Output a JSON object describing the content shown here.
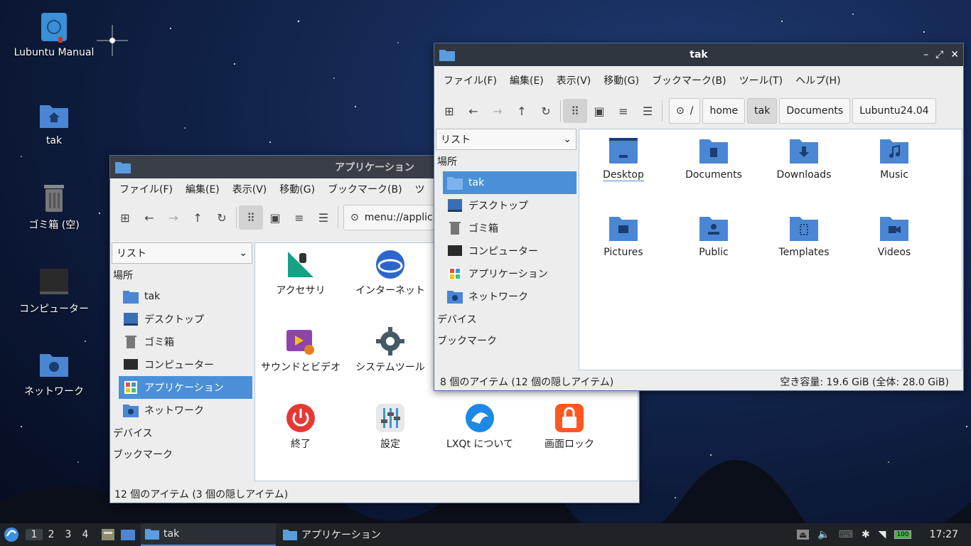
{
  "desktop": {
    "icons": [
      {
        "label": "Lubuntu Manual"
      },
      {
        "label": "tak"
      },
      {
        "label": "ゴミ箱 (空)"
      },
      {
        "label": "コンピューター"
      },
      {
        "label": "ネットワーク"
      }
    ]
  },
  "apps_window": {
    "title": "アプリケーション",
    "menu": [
      "ファイル(F)",
      "編集(E)",
      "表示(V)",
      "移動(G)",
      "ブックマーク(B)",
      "ツ"
    ],
    "location": "menu://applic",
    "view_select": "リスト",
    "sections": {
      "places": "場所",
      "devices": "デバイス",
      "bookmarks": "ブックマーク"
    },
    "places": [
      "tak",
      "デスクトップ",
      "ゴミ箱",
      "コンピューター",
      "アプリケーション",
      "ネットワーク"
    ],
    "items": [
      "アクセサリ",
      "インターネット",
      "サウンドとビデオ",
      "システムツール",
      "終了",
      "設定",
      "LXQt について",
      "画面ロック"
    ],
    "status": "12 個のアイテム (3 個の隠しアイテム)"
  },
  "tak_window": {
    "title": "tak",
    "menu": [
      "ファイル(F)",
      "編集(E)",
      "表示(V)",
      "移動(G)",
      "ブックマーク(B)",
      "ツール(T)",
      "ヘルプ(H)"
    ],
    "breadcrumbs": [
      "/",
      "home",
      "tak",
      "Documents",
      "Lubuntu24.04"
    ],
    "view_select": "リスト",
    "sections": {
      "places": "場所",
      "devices": "デバイス",
      "bookmarks": "ブックマーク"
    },
    "places": [
      "tak",
      "デスクトップ",
      "ゴミ箱",
      "コンピューター",
      "アプリケーション",
      "ネットワーク"
    ],
    "items": [
      "Desktop",
      "Documents",
      "Downloads",
      "Music",
      "Pictures",
      "Public",
      "Templates",
      "Videos"
    ],
    "status_left": "8 個のアイテム (12 個の隠しアイテム)",
    "status_right": "空き容量: 19.6 GiB (全体: 28.0 GiB)"
  },
  "taskbar": {
    "workspaces": [
      "1",
      "2",
      "3",
      "4"
    ],
    "tasks": [
      "tak",
      "アプリケーション"
    ],
    "clock": "17:27",
    "battery": "100"
  },
  "colors": {
    "accent": "#4a90d9",
    "folder": "#4a86d4",
    "titlebar": "#2f3640"
  }
}
